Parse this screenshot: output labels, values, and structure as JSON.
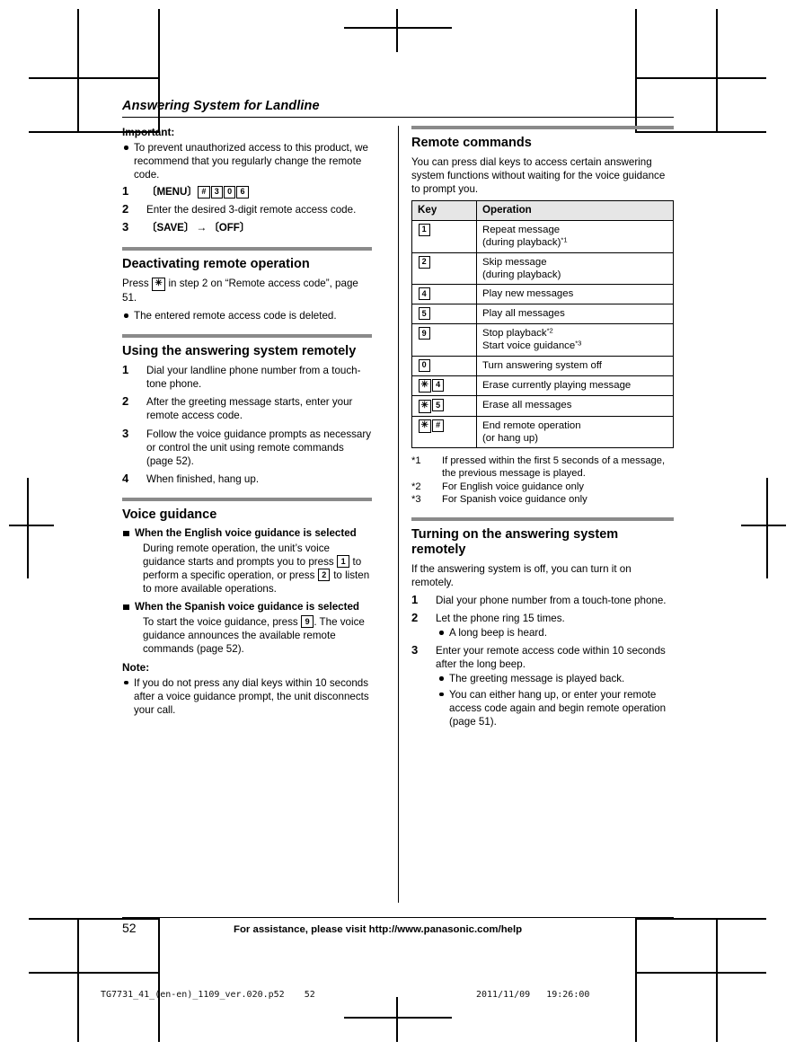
{
  "running_head": "Answering System for Landline",
  "left_column": {
    "important": {
      "label": "Important:",
      "bullets": [
        "To prevent unauthorized access to this product, we recommend that you regularly change the remote code."
      ],
      "steps": [
        {
          "num": "1",
          "softkey": "〔MENU〕",
          "keys": [
            "#",
            "3",
            "0",
            "6"
          ]
        },
        {
          "num": "2",
          "text": "Enter the desired 3-digit remote access code."
        },
        {
          "num": "3",
          "softkey_a": "〔SAVE〕",
          "arrow": "→",
          "softkey_b": "〔OFF〕"
        }
      ]
    },
    "deactivating": {
      "heading": "Deactivating remote operation",
      "text_before_key": "Press ",
      "key": "✳",
      "text_after_key": " in step 2 on “Remote access code”, page 51.",
      "bullets": [
        "The entered remote access code is deleted."
      ]
    },
    "using_remotely": {
      "heading": "Using the answering system remotely",
      "steps": [
        {
          "num": "1",
          "text": "Dial your landline phone number from a touch-tone phone."
        },
        {
          "num": "2",
          "text": "After the greeting message starts, enter your remote access code."
        },
        {
          "num": "3",
          "text": "Follow the voice guidance prompts as necessary or control the unit using remote commands (page 52)."
        },
        {
          "num": "4",
          "text": "When finished, hang up."
        }
      ]
    },
    "voice_guidance": {
      "heading": "Voice guidance",
      "english": {
        "head": "When the English voice guidance is selected",
        "body_1": "During remote operation, the unit’s voice guidance starts and prompts you to press ",
        "key_1": "1",
        "body_2": " to perform a specific operation, or press ",
        "key_2": "2",
        "body_3": " to listen to more available operations."
      },
      "spanish": {
        "head": "When the Spanish voice guidance is selected",
        "body_1": "To start the voice guidance, press ",
        "key_1": "9",
        "body_2": ". The voice guidance announces the available remote commands (page 52)."
      },
      "note_label": "Note:",
      "note_bullets": [
        "If you do not press any dial keys within 10 seconds after a voice guidance prompt, the unit disconnects your call."
      ]
    }
  },
  "right_column": {
    "remote_commands": {
      "heading": "Remote commands",
      "lead": "You can press dial keys to access certain answering system functions without waiting for the voice guidance to prompt you.",
      "table": {
        "headers": [
          "Key",
          "Operation"
        ],
        "rows": [
          {
            "keys": [
              "1"
            ],
            "lines": [
              "Repeat message",
              "(during playback)"
            ],
            "footnote": "*1"
          },
          {
            "keys": [
              "2"
            ],
            "lines": [
              "Skip message",
              "(during playback)"
            ],
            "footnote": ""
          },
          {
            "keys": [
              "4"
            ],
            "lines": [
              "Play new messages"
            ],
            "footnote": ""
          },
          {
            "keys": [
              "5"
            ],
            "lines": [
              "Play all messages"
            ],
            "footnote": ""
          },
          {
            "keys": [
              "9"
            ],
            "lines": [
              "Stop playback",
              "Start voice guidance"
            ],
            "footnote_per_line": [
              "*2",
              "*3"
            ]
          },
          {
            "keys": [
              "0"
            ],
            "lines": [
              "Turn answering system off"
            ],
            "footnote": ""
          },
          {
            "keys": [
              "✳",
              "4"
            ],
            "lines": [
              "Erase currently playing message"
            ],
            "footnote": ""
          },
          {
            "keys": [
              "✳",
              "5"
            ],
            "lines": [
              "Erase all messages"
            ],
            "footnote": ""
          },
          {
            "keys": [
              "✳",
              "#"
            ],
            "lines": [
              "End remote operation",
              "(or hang up)"
            ],
            "footnote": ""
          }
        ]
      },
      "footnotes": [
        {
          "mark": "*1",
          "text": "If pressed within the first 5 seconds of a message, the previous message is played."
        },
        {
          "mark": "*2",
          "text": "For English voice guidance only"
        },
        {
          "mark": "*3",
          "text": "For Spanish voice guidance only"
        }
      ]
    },
    "turning_on": {
      "heading": "Turning on the answering system remotely",
      "lead": "If the answering system is off, you can turn it on remotely.",
      "steps": [
        {
          "num": "1",
          "text": "Dial your phone number from a touch-tone phone.",
          "bullets": []
        },
        {
          "num": "2",
          "text": "Let the phone ring 15 times.",
          "bullets": [
            "A long beep is heard."
          ]
        },
        {
          "num": "3",
          "text": "Enter your remote access code within 10 seconds after the long beep.",
          "bullets": [
            "The greeting message is played back.",
            "You can either hang up, or enter your remote access code again and begin remote operation (page 51)."
          ]
        }
      ]
    }
  },
  "footer": {
    "page_number": "52",
    "assistance": "For assistance, please visit http://www.panasonic.com/help"
  },
  "slug": {
    "file": "TG7731_41_(en-en)_1109_ver.020.p52",
    "page": "52",
    "date": "2011/11/09",
    "time": "19:26:00"
  }
}
